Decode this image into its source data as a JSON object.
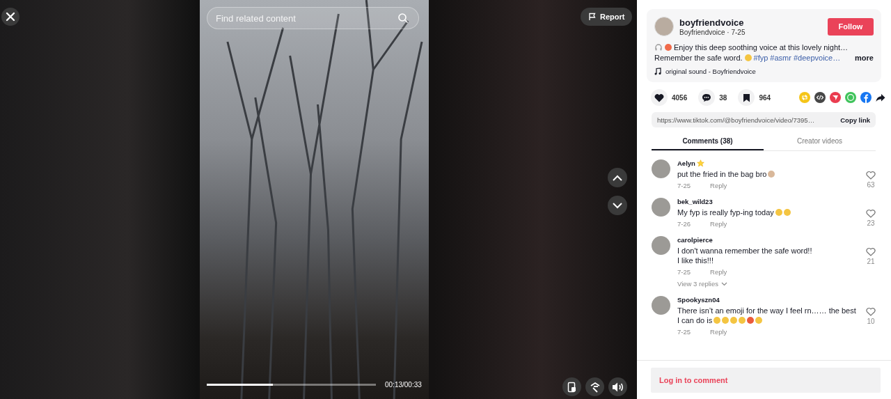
{
  "video": {
    "search": {
      "placeholder": "Find related content"
    },
    "report": "Report",
    "progress": {
      "level": 0.39
    },
    "time": "00:13/00:33"
  },
  "post": {
    "username": "boyfriendvoice",
    "nickname": "Boyfriendvoice · 7-25",
    "follow": "Follow",
    "description_line1": "Enjoy this deep soothing voice at this lovely night…",
    "description_line2": "Remember the safe word.",
    "hashtags": [
      "#fyp",
      "#asmr",
      "#deepvoice…"
    ],
    "more": "more",
    "sound": "original sound - Boyfriendvoice"
  },
  "stats": [
    {
      "kind": "like",
      "count": "4056"
    },
    {
      "kind": "comment",
      "count": "38"
    },
    {
      "kind": "save",
      "count": "964"
    }
  ],
  "share": [
    {
      "kind": "repost",
      "color": "#f5c518"
    },
    {
      "kind": "embed",
      "color": "#474747"
    },
    {
      "kind": "send",
      "color": "#ea3c4f"
    },
    {
      "kind": "whatsapp",
      "color": "#3fc35a"
    },
    {
      "kind": "facebook",
      "color": "#1877f2"
    },
    {
      "kind": "forward",
      "color": "#161823"
    }
  ],
  "link": {
    "url": "https://www.tiktok.com/@boyfriendvoice/video/7395…",
    "copy": "Copy link"
  },
  "tabs": [
    {
      "label": "Comments (38)",
      "selected": true
    },
    {
      "label": "Creator videos",
      "selected": false
    }
  ],
  "comments": [
    {
      "user": "Aelyn",
      "star": true,
      "lines": [
        "put the fried in the bag bro"
      ],
      "emojis": [
        {
          "kind": "hands"
        }
      ],
      "date": "7-25",
      "reply": "Reply",
      "likes": "63"
    },
    {
      "user": "bek_wild23",
      "star": false,
      "lines": [
        "My fyp is really fyp-ing today"
      ],
      "emojis": [
        {
          "kind": "smile"
        },
        {
          "kind": "smile"
        }
      ],
      "date": "7-26",
      "reply": "Reply",
      "likes": "23"
    },
    {
      "user": "carolpierce",
      "star": false,
      "lines": [
        "I don't wanna remember the safe word!!",
        "I like this!!!"
      ],
      "date": "7-25",
      "reply": "Reply",
      "likes": "21",
      "replies": "View 3 replies"
    },
    {
      "user": "Spookyszn04",
      "star": false,
      "lines": [
        "There isn’t an emoji for the way I feel rn…… the best",
        "I can do is"
      ],
      "emojis": [
        {
          "kind": "smile"
        },
        {
          "kind": "smile"
        },
        {
          "kind": "smile"
        },
        {
          "kind": "smile"
        },
        {
          "kind": "angry"
        },
        {
          "kind": "smile"
        }
      ],
      "date": "7-25",
      "reply": "Reply",
      "likes": "10"
    }
  ],
  "login": "Log in to comment"
}
